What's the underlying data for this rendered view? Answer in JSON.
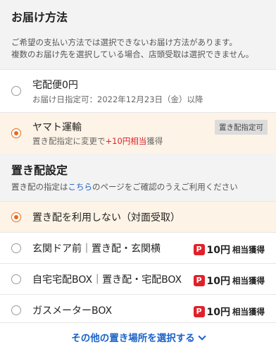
{
  "delivery": {
    "title": "お届け方法",
    "desc_line1": "ご希望の支払い方法では選択できないお届け方法があります。",
    "desc_line2": "複数のお届け先を選択している場合、店頭受取は選択できません。",
    "options": [
      {
        "title": "宅配便0円",
        "sub": "お届け日指定可：2022年12月23日（金）以降",
        "selected": false
      },
      {
        "title": "ヤマト運輸",
        "sub_prefix": "置き配指定に変更で",
        "sub_points": "+10円相当",
        "sub_suffix": "獲得",
        "badge": "置き配指定可",
        "selected": true
      }
    ]
  },
  "okihai": {
    "title": "置き配設定",
    "desc_prefix": "置き配の指定は",
    "desc_link": "こちら",
    "desc_suffix": "のページをご確認のうえご利用ください",
    "options": [
      {
        "label": "置き配を利用しない（対面受取）",
        "selected": true
      },
      {
        "label": "玄関ドア前｜置き配・玄関横",
        "points": "10円",
        "points_unit": "相当獲得",
        "icon": "P",
        "selected": false
      },
      {
        "label": "自宅宅配BOX｜置き配・宅配BOX",
        "points": "10円",
        "points_unit": "相当獲得",
        "icon": "P",
        "selected": false
      },
      {
        "label": "ガスメーターBOX",
        "points": "10円",
        "points_unit": "相当獲得",
        "icon": "P",
        "selected": false
      }
    ],
    "more_label": "その他の置き場所を選択する"
  },
  "colors": {
    "accent": "#e86a1a",
    "link": "#1a62c8",
    "points_red": "#e1212a",
    "selected_bg": "#fdf3e6"
  }
}
